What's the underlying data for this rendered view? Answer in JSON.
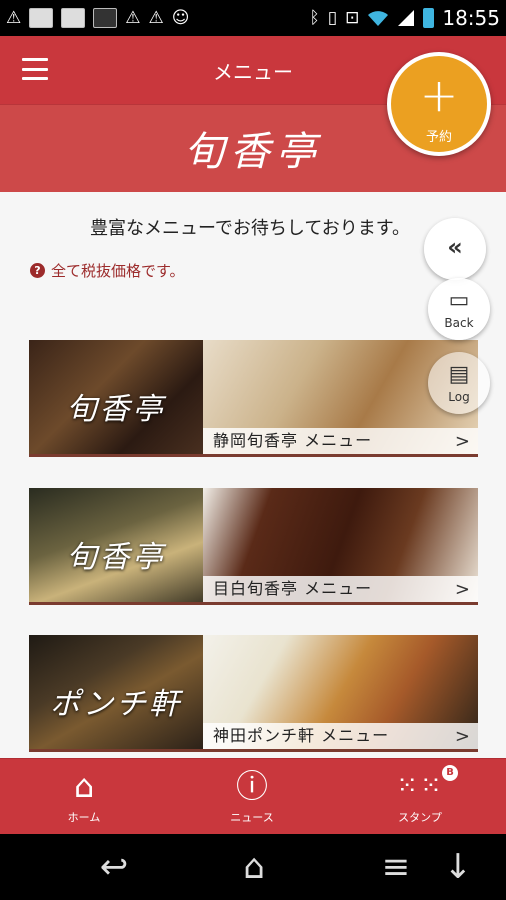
{
  "status_bar": {
    "time": "18:55",
    "left_icons": [
      "warning-icon",
      "flag-icon",
      "map-icon",
      "tower-icon",
      "warning-icon",
      "warning-icon",
      "android-icon"
    ],
    "right_icons": [
      "bluetooth-icon",
      "vibrate-icon",
      "nfc-icon",
      "wifi-icon",
      "signal-icon",
      "battery-icon"
    ]
  },
  "app_bar": {
    "title": "メニュー",
    "logo": "旬香亭"
  },
  "fab": {
    "plus": "+",
    "label": "予約"
  },
  "main": {
    "headline": "豊富なメニューでお待ちしております。",
    "note": "全て税抜価格です。",
    "note_icon": "?"
  },
  "side_buttons": {
    "collapse": "«",
    "back": "Back",
    "log": "Log"
  },
  "banners": [
    {
      "logo": "旬香亭",
      "label": "静岡旬香亭 メニュー",
      "chevron": ">"
    },
    {
      "logo": "旬香亭",
      "label": "目白旬香亭 メニュー",
      "chevron": ">"
    },
    {
      "logo": "ポンチ軒",
      "label": "神田ポンチ軒 メニュー",
      "chevron": ">"
    }
  ],
  "tab_bar": {
    "home_label": "ホーム",
    "news_label": "ニュース",
    "stamp_label": "スタンプ",
    "stamp_badge": "B"
  },
  "colors": {
    "brand_red": "#c9373d",
    "logo_band": "#cd4949",
    "fab_orange": "#eba021"
  }
}
